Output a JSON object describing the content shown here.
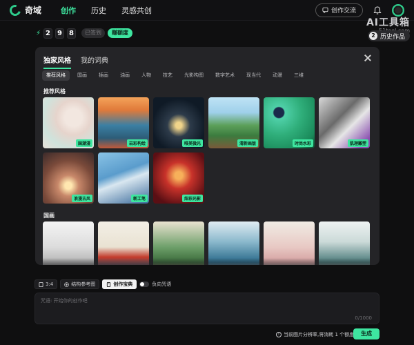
{
  "app": {
    "name": "奇域"
  },
  "nav": {
    "items": [
      "创作",
      "历史",
      "灵感共创"
    ]
  },
  "header": {
    "exchange_label": "创作交流"
  },
  "points": {
    "digits": [
      "2",
      "9",
      "8"
    ],
    "signed_label": "已签到",
    "earn_label": "赚额度"
  },
  "watermark": {
    "title": "AI工具箱",
    "subtitle": "51tool.com"
  },
  "history": {
    "count": "2",
    "label": "历史作品"
  },
  "panel": {
    "tabs": [
      "独家风格",
      "我的词典"
    ],
    "categories": [
      "推荐风格",
      "国画",
      "插画",
      "油画",
      "人物",
      "技艺",
      "光影构图",
      "数字艺术",
      "现当代",
      "动漫",
      "三维"
    ],
    "sections": {
      "recommended": "推荐风格",
      "guohua": "国画"
    },
    "recommended_styles": [
      "国潮漫",
      "岩彩构绘",
      "唯美微光",
      "清新画版",
      "时尚水彩",
      "肌理雕塑",
      "浪漫古风",
      "新工笔",
      "炫彩光影"
    ]
  },
  "tools": {
    "ratio": "3:4",
    "structure": "结构参考图",
    "codex": "创作宝典",
    "negative": "负向咒语"
  },
  "prompt": {
    "placeholder": "咒语: 开始你的创作吧",
    "counter": "0/1000"
  },
  "footer": {
    "info": "当前图片分辨率,将消耗 1 个额度",
    "generate_label": "生成"
  },
  "colors": {
    "accent": "#3ee6a0",
    "panel": "#242427",
    "background": "#0f0f10"
  }
}
